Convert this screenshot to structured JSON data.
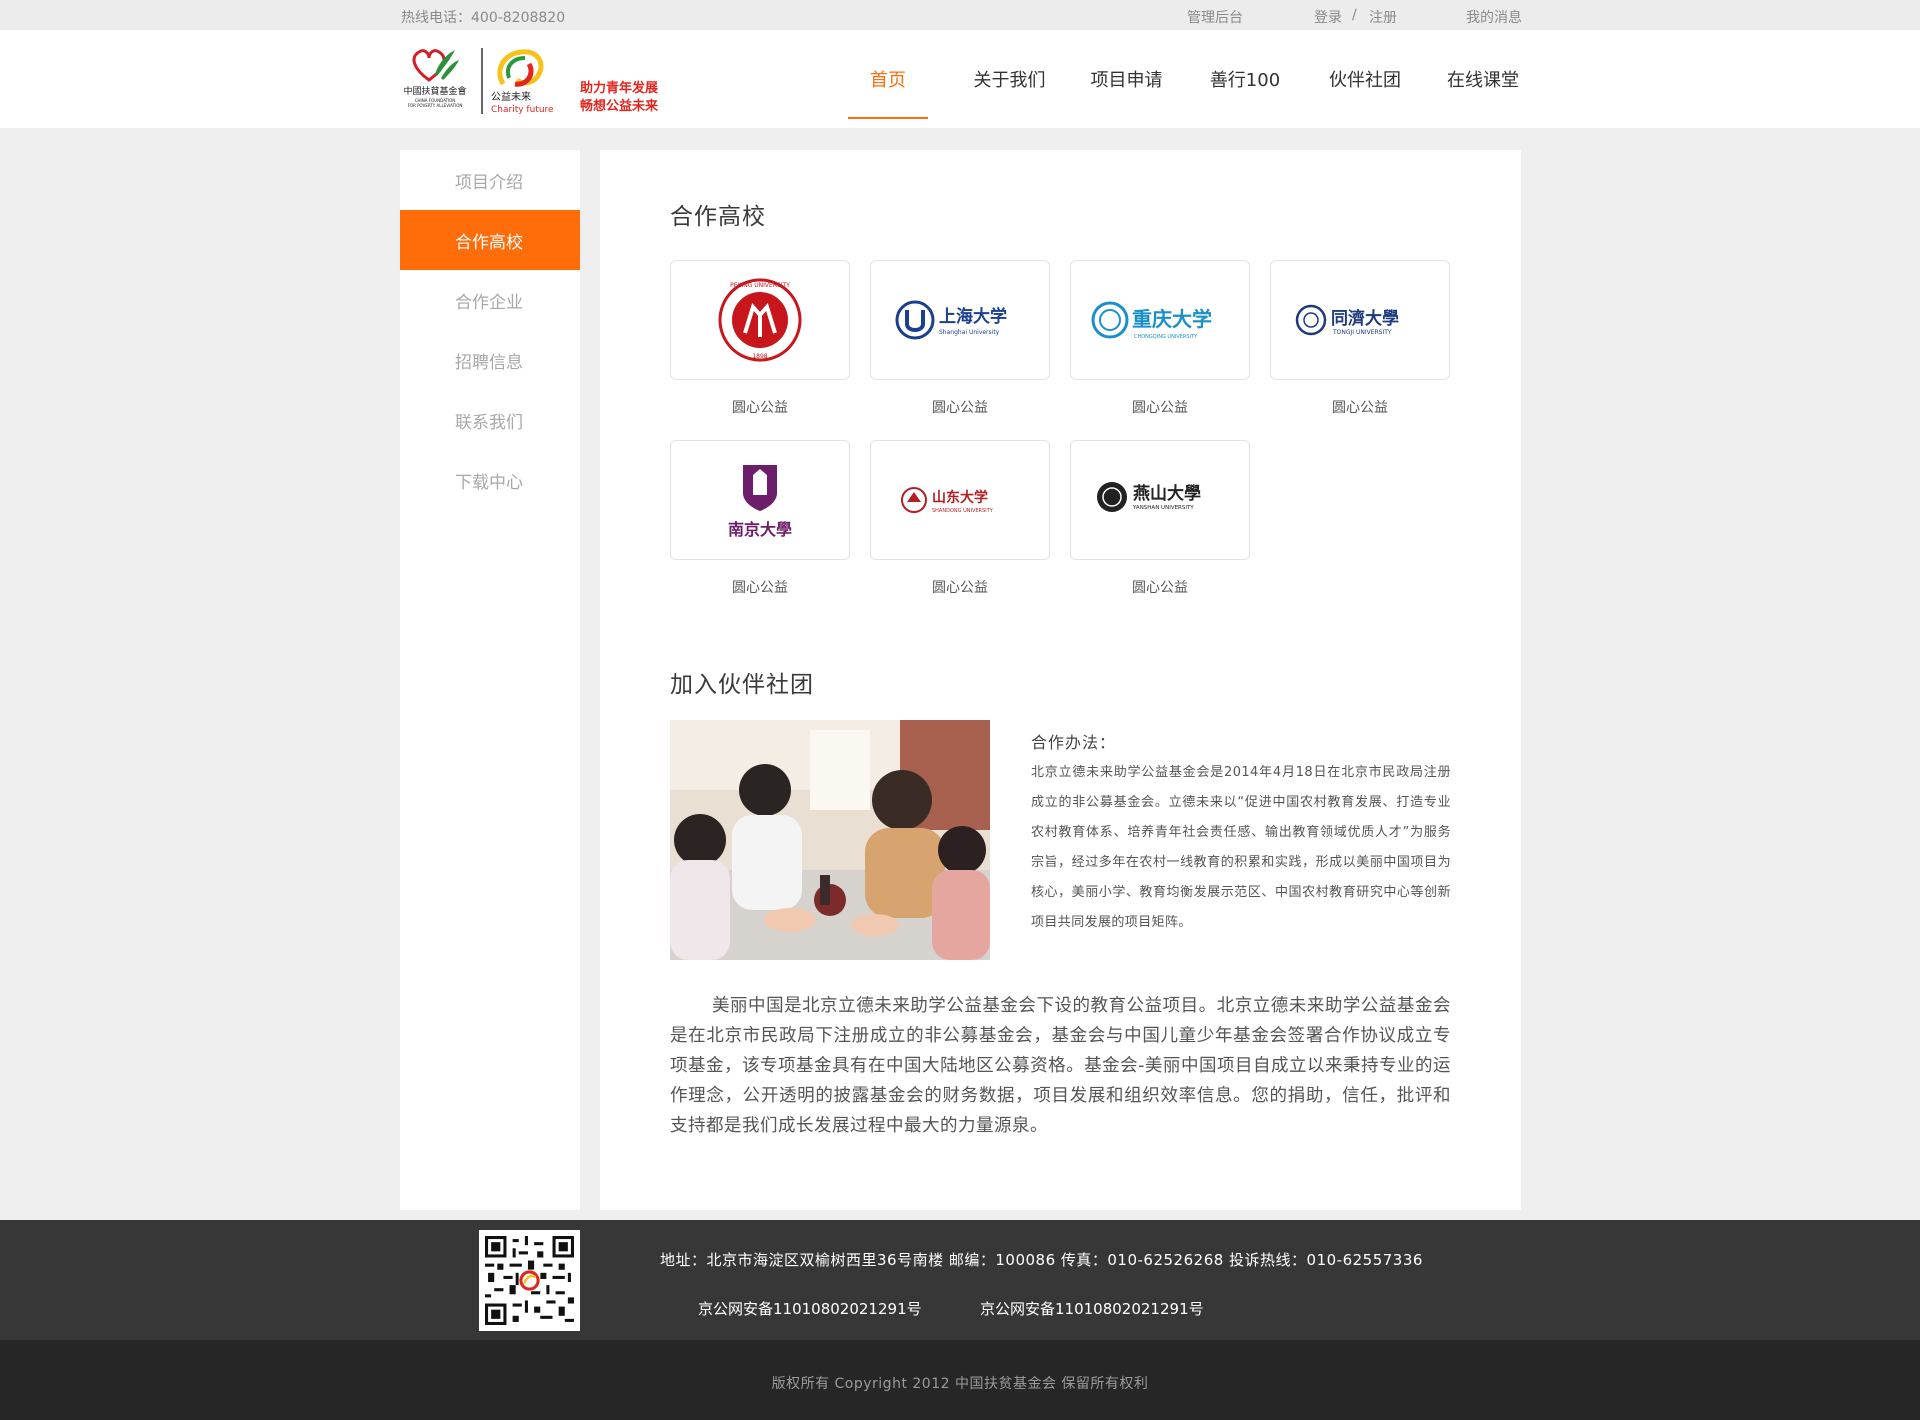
{
  "topbar": {
    "phone": "热线电话：400-8208820",
    "admin": "管理后台",
    "login": "登录",
    "separator": "/",
    "register": "注册",
    "messages": "我的消息"
  },
  "logo": {
    "foundation_lines": [
      "中國扶貧基金會",
      "CHINA FOUNDATION",
      "FOR POVERTY ALLEVIATION"
    ],
    "brand_cn": "公益未来",
    "brand_en": "Charity future",
    "slogan_1": "助力青年发展",
    "slogan_2": "畅想公益未来"
  },
  "nav": {
    "items": [
      {
        "label": "首页",
        "active": true
      },
      {
        "label": "关于我们",
        "active": false
      },
      {
        "label": "项目申请",
        "active": false
      },
      {
        "label": "善行100",
        "active": false
      },
      {
        "label": "伙伴社团",
        "active": false
      },
      {
        "label": "在线课堂",
        "active": false
      }
    ]
  },
  "sidebar": {
    "items": [
      {
        "label": "项目介绍",
        "active": false
      },
      {
        "label": "合作高校",
        "active": true
      },
      {
        "label": "合作企业",
        "active": false
      },
      {
        "label": "招聘信息",
        "active": false
      },
      {
        "label": "联系我们",
        "active": false
      },
      {
        "label": "下载中心",
        "active": false
      }
    ]
  },
  "universities": {
    "title": "合作高校",
    "items": [
      {
        "name": "北京大学",
        "caption": "圆心公益",
        "logo_text": "PEKING UNIVERSITY",
        "year": "1898",
        "color": "#c8161d"
      },
      {
        "name": "上海大学",
        "caption": "圆心公益",
        "logo_text": "上海大学",
        "sub": "Shanghai University",
        "color": "#1a3f8f"
      },
      {
        "name": "重庆大学",
        "caption": "圆心公益",
        "logo_text": "重庆大学",
        "sub": "CHONGQING UNIVERSITY",
        "color": "#1a8fc8"
      },
      {
        "name": "同济大学",
        "caption": "圆心公益",
        "logo_text": "同濟大學",
        "sub": "TONGJI UNIVERSITY",
        "color": "#1d3a7a"
      },
      {
        "name": "南京大学",
        "caption": "圆心公益",
        "logo_text": "南京大學",
        "color": "#6d1e6a"
      },
      {
        "name": "山东大学",
        "caption": "圆心公益",
        "logo_text": "山东大学",
        "sub": "SHANDONG UNIVERSITY",
        "color": "#b41f24"
      },
      {
        "name": "燕山大学",
        "caption": "圆心公益",
        "logo_text": "燕山大學",
        "sub": "YANSHAN UNIVERSITY",
        "color": "#222222"
      }
    ]
  },
  "partner": {
    "title": "加入伙伴社团",
    "coop_title": "合作办法：",
    "coop_body": "北京立德未来助学公益基金会是2014年4月18日在北京市民政局注册成立的非公募基金会。立德未来以“促进中国农村教育发展、打造专业农村教育体系、培养青年社会责任感、输出教育领域优质人才”为服务宗旨，经过多年在农村一线教育的积累和实践，形成以美丽中国项目为核心，美丽小学、教育均衡发展示范区、中国农村教育研究中心等创新项目共同发展的项目矩阵。",
    "intro": "美丽中国是北京立德未来助学公益基金会下设的教育公益项目。北京立德未来助学公益基金会是在北京市民政局下注册成立的非公募基金会，基金会与中国儿童少年基金会签署合作协议成立专项基金，该专项基金具有在中国大陆地区公募资格。基金会-美丽中国项目自成立以来秉持专业的运作理念，公开透明的披露基金会的财务数据，项目发展和组织效率信息。您的捐助，信任，批评和支持都是我们成长发展过程中最大的力量源泉。"
  },
  "footer": {
    "address": "地址：北京市海淀区双榆树西里36号南楼 邮编：100086 传真：010-62526268 投诉热线：010-62557336",
    "icp_1": "京公网安备11010802021291号",
    "icp_2": "京公网安备11010802021291号",
    "copyright": "版权所有 Copyright 2012 中国扶贫基金会 保留所有权利"
  },
  "colors": {
    "accent": "#ff6d0a",
    "footer_top": "#373737",
    "footer_bottom": "#262626",
    "page_bg": "#efefef"
  }
}
